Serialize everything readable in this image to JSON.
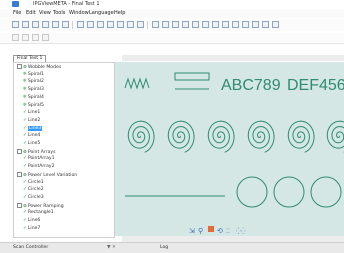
{
  "window": {
    "title": "IPGViewMETA - Final Test 1"
  },
  "menu": [
    "File",
    "Edit",
    "View",
    "Tools",
    "Window",
    "Language",
    "Help"
  ],
  "document_tab": "Final Test 1",
  "tree": [
    {
      "indent": 0,
      "type": "group",
      "label": "Wobble Modes"
    },
    {
      "indent": 2,
      "type": "spiral",
      "label": "Spiral1"
    },
    {
      "indent": 2,
      "type": "spiral",
      "label": "Spiral2"
    },
    {
      "indent": 2,
      "type": "spiral",
      "label": "Spiral3"
    },
    {
      "indent": 2,
      "type": "spiral",
      "label": "Spiral4"
    },
    {
      "indent": 2,
      "type": "spiral",
      "label": "Spiral5"
    },
    {
      "indent": 2,
      "type": "line",
      "label": "Line1"
    },
    {
      "indent": 2,
      "type": "line",
      "label": "Line2"
    },
    {
      "indent": 2,
      "type": "line",
      "label": "Line3",
      "selected": true
    },
    {
      "indent": 2,
      "type": "line",
      "label": "Line4"
    },
    {
      "indent": 2,
      "type": "line",
      "label": "Line5"
    },
    {
      "indent": 0,
      "type": "group",
      "label": "Point Arrays"
    },
    {
      "indent": 2,
      "type": "point",
      "label": "PointArray1"
    },
    {
      "indent": 2,
      "type": "point",
      "label": "PointArray2"
    },
    {
      "indent": 0,
      "type": "group",
      "label": "Power Level Variation"
    },
    {
      "indent": 2,
      "type": "circle",
      "label": "Circle1"
    },
    {
      "indent": 2,
      "type": "circle",
      "label": "Circle2"
    },
    {
      "indent": 2,
      "type": "circle",
      "label": "Circle3"
    },
    {
      "indent": 0,
      "type": "group",
      "label": "Power Ramping"
    },
    {
      "indent": 2,
      "type": "rect",
      "label": "Rectangle1"
    },
    {
      "indent": 2,
      "type": "line",
      "label": "Line6"
    },
    {
      "indent": 2,
      "type": "line",
      "label": "Line7"
    }
  ],
  "canvas": {
    "text1": "ABC789",
    "text2": "DEF456",
    "stroke": "#2f8c6e",
    "background": "#d4e7e5"
  },
  "status": {
    "left": "Scan Controller",
    "close": "▼ ✕",
    "right": "Log"
  },
  "colors": {
    "selection": "#3399ff",
    "tree_check": "#2e8b3e"
  }
}
